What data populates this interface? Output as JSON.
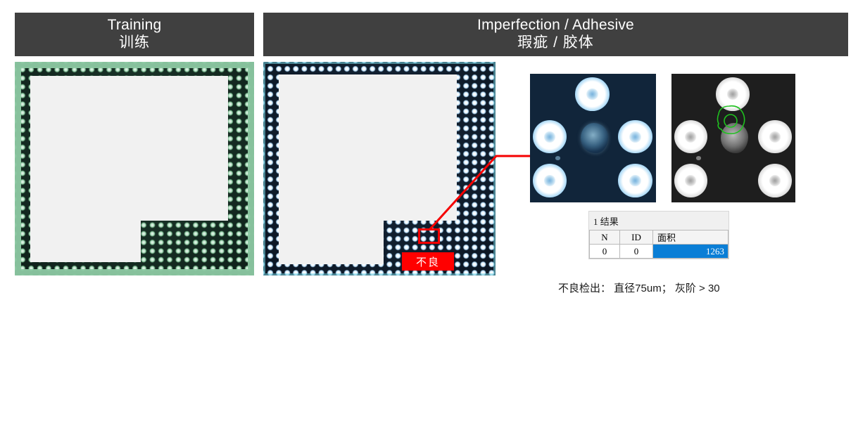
{
  "panels": [
    {
      "id": "training",
      "title_en": "Training",
      "title_cn": "训练",
      "image_name": "bga-substrate-training-image"
    },
    {
      "id": "defect",
      "title_en": "Imperfection / Adhesive",
      "title_cn": "瑕疵 / 胶体",
      "image_name": "bga-substrate-inspection-image"
    }
  ],
  "overlays": {
    "defect_badge_label": "不良",
    "defect_box_color": "#f50000",
    "badge_background": "#ff0000",
    "leader_line_color": "#f50000"
  },
  "magnified": {
    "color_crop_name": "magnified-color-inspection-crop",
    "gray_crop_name": "magnified-grayscale-contour-crop",
    "contour_color": "#1fc11f"
  },
  "results": {
    "title": "1 结果",
    "columns": [
      "N",
      "ID",
      "面积"
    ],
    "rows": [
      {
        "n": "0",
        "id": "0",
        "area": "1263"
      }
    ],
    "highlight_color": "#0a7ed6"
  },
  "caption": {
    "text": "不良检出：  直径75um；  灰阶 > 30"
  },
  "theme": {
    "banner_background": "#404040",
    "banner_text": "#ffffff",
    "page_background": "#ffffff"
  }
}
